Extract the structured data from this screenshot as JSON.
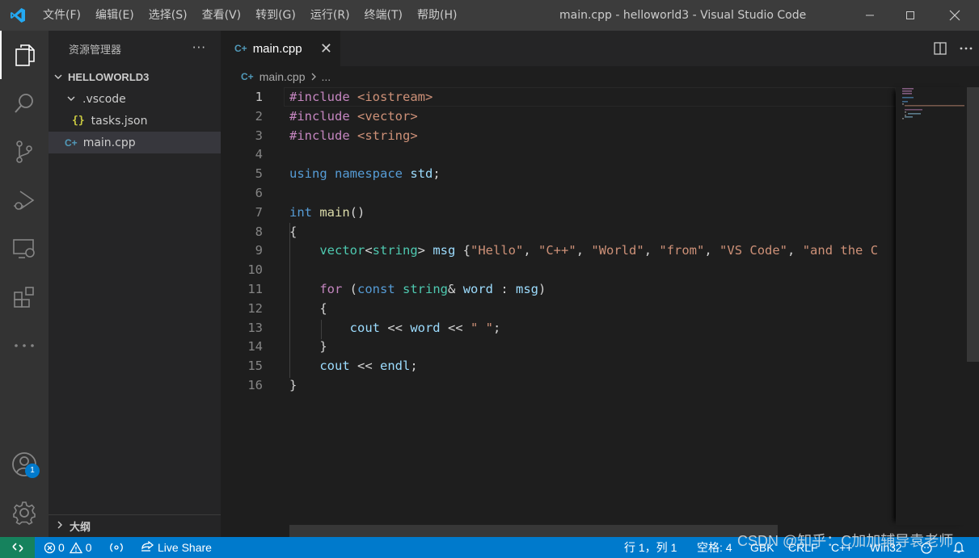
{
  "title_bar": {
    "app_icon": "vscode-logo-icon",
    "menu": [
      "文件(F)",
      "编辑(E)",
      "选择(S)",
      "查看(V)",
      "转到(G)",
      "运行(R)",
      "终端(T)",
      "帮助(H)"
    ],
    "window_title": "main.cpp - helloworld3 - Visual Studio Code",
    "controls": [
      "minimize-icon",
      "maximize-icon",
      "close-icon"
    ]
  },
  "activity_bar": {
    "icons": [
      "explorer-icon",
      "search-icon",
      "source-control-icon",
      "run-debug-icon",
      "remote-explorer-icon",
      "extensions-icon",
      "more-icon"
    ],
    "bottom_icons": [
      "accounts-icon",
      "manage-gear-icon"
    ],
    "accounts_badge": "1"
  },
  "sidebar": {
    "title": "资源管理器",
    "more": "···",
    "root": "HELLOWORLD3",
    "tree": [
      {
        "label": ".vscode",
        "type": "folder"
      },
      {
        "label": "tasks.json",
        "type": "json",
        "icon": "{}"
      },
      {
        "label": "main.cpp",
        "type": "cpp",
        "icon": "C+",
        "selected": true
      }
    ],
    "outline": "大纲"
  },
  "editor": {
    "tab": {
      "label": "main.cpp",
      "icon": "C+",
      "close": "✕"
    },
    "tab_actions": [
      "split-editor-icon",
      "more-actions-icon"
    ],
    "breadcrumb": {
      "file": "main.cpp",
      "rest": "..."
    },
    "line_numbers": [
      "1",
      "2",
      "3",
      "4",
      "5",
      "6",
      "7",
      "8",
      "9",
      "10",
      "11",
      "12",
      "13",
      "14",
      "15",
      "16"
    ],
    "current_line": 1,
    "code_lines": [
      "#include <iostream>",
      "#include <vector>",
      "#include <string>",
      "",
      "using namespace std;",
      "",
      "int main()",
      "{",
      "    vector<string> msg {\"Hello\", \"C++\", \"World\", \"from\", \"VS Code\", \"and the C",
      "",
      "    for (const string& word : msg)",
      "    {",
      "        cout << word << \" \";",
      "    }",
      "    cout << endl;",
      "}"
    ]
  },
  "status_bar": {
    "remote_icon": "remote-icon",
    "errors": "0",
    "warnings": "0",
    "broadcast_icon": "broadcast-icon",
    "live_share": "Live Share",
    "position": "行 1，列 1",
    "spaces": "空格: 4",
    "encoding": "GBK",
    "eol": "CRLF",
    "language": "C++",
    "platform": "Win32",
    "feedback_icon": "feedback-icon",
    "bell_icon": "bell-icon"
  },
  "watermark": "CSDN @知乎：C加加辅导袁老师",
  "colors": {
    "title_bar": "#3c3c3c",
    "activity_bar": "#333333",
    "sidebar": "#252526",
    "editor": "#1e1e1e",
    "status_bar": "#007acc",
    "remote": "#16825d"
  }
}
